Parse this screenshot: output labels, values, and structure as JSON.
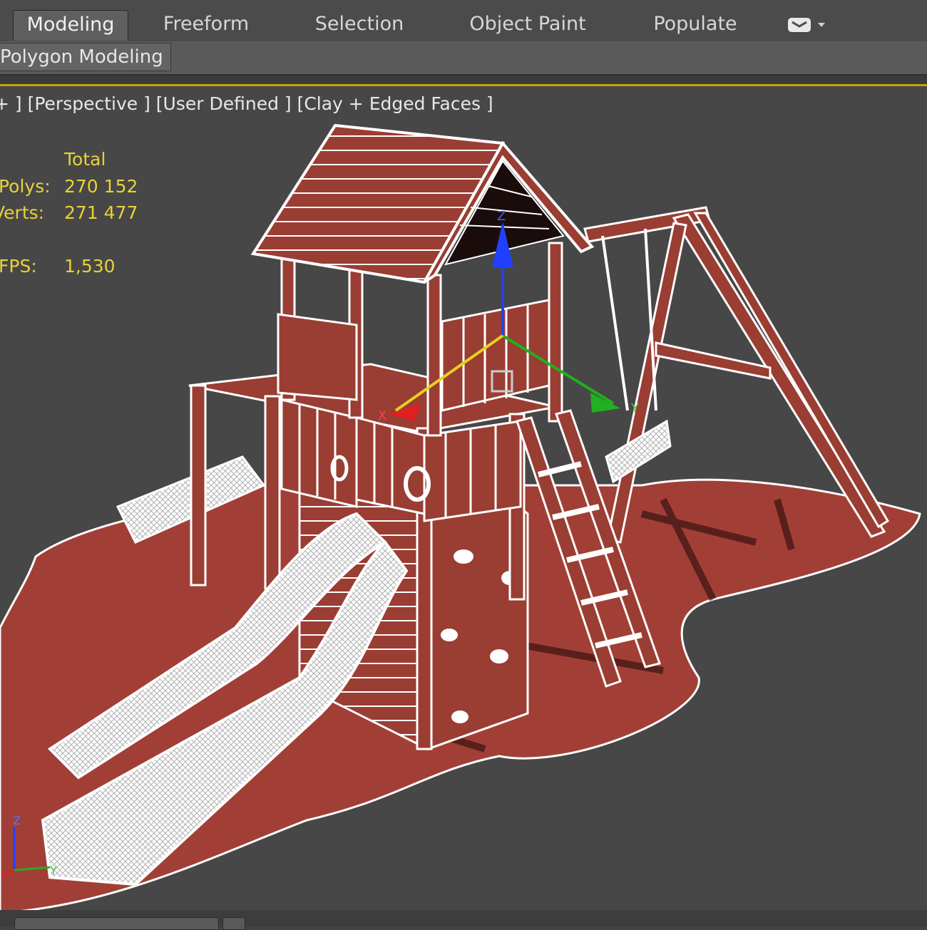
{
  "ribbon": {
    "tabs": [
      {
        "label": "Modeling",
        "active": true
      },
      {
        "label": "Freeform",
        "active": false
      },
      {
        "label": "Selection",
        "active": false
      },
      {
        "label": "Object Paint",
        "active": false
      },
      {
        "label": "Populate",
        "active": false
      }
    ],
    "extra_icon": "ribbon-options-icon",
    "panel_label": "Polygon Modeling"
  },
  "viewport": {
    "label": "+ ] [Perspective ] [User Defined ] [Clay + Edged Faces ]",
    "stats": {
      "header": "Total",
      "polys_label": "Polys:",
      "polys_value": "270 152",
      "verts_label": "Verts:",
      "verts_value": "271 477",
      "fps_label": "FPS:",
      "fps_value": "1,530"
    },
    "gizmo": {
      "x_label": "X",
      "y_label": "Y",
      "z_label": "Z"
    },
    "axis_tripod": {
      "x_label": "X",
      "y_label": "Y",
      "z_label": "Z"
    }
  },
  "colors": {
    "accent_border": "#c79f1a",
    "model_fill": "#9a3d33",
    "wire": "#ffffff",
    "stats_text": "#e8d13a",
    "axis_x": "#e02020",
    "axis_y": "#20b020",
    "axis_z": "#2040ff"
  }
}
